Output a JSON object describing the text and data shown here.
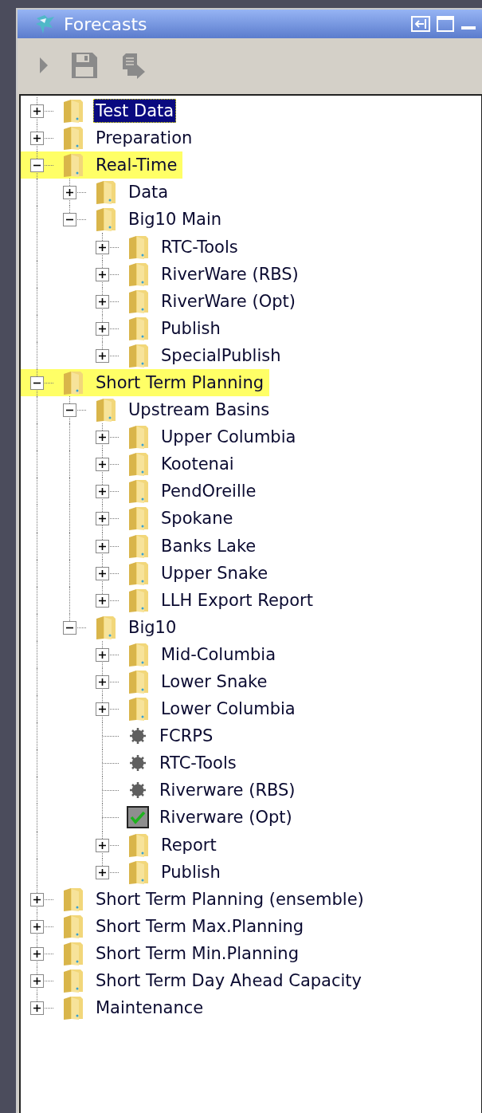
{
  "window": {
    "title": "Forecasts"
  },
  "toolbar": [
    {
      "kind": "run",
      "disabled": true
    },
    {
      "kind": "save",
      "disabled": true
    },
    {
      "kind": "export",
      "disabled": true
    }
  ],
  "tree": [
    {
      "label": "Test Data",
      "kind": "folder",
      "expanded": false,
      "selected": true,
      "highlighted": false
    },
    {
      "label": "Preparation",
      "kind": "folder",
      "expanded": false,
      "selected": false,
      "highlighted": false
    },
    {
      "label": "Real-Time",
      "kind": "folder",
      "expanded": true,
      "selected": false,
      "highlighted": true,
      "children": [
        {
          "label": "Data",
          "kind": "folder",
          "expanded": false,
          "selected": false,
          "highlighted": false
        },
        {
          "label": "Big10 Main",
          "kind": "folder",
          "expanded": true,
          "selected": false,
          "highlighted": false,
          "children": [
            {
              "label": "RTC-Tools",
              "kind": "folder",
              "expanded": false,
              "selected": false,
              "highlighted": false
            },
            {
              "label": "RiverWare (RBS)",
              "kind": "folder",
              "expanded": false,
              "selected": false,
              "highlighted": false
            },
            {
              "label": "RiverWare (Opt)",
              "kind": "folder",
              "expanded": false,
              "selected": false,
              "highlighted": false
            },
            {
              "label": "Publish",
              "kind": "folder",
              "expanded": false,
              "selected": false,
              "highlighted": false
            },
            {
              "label": "SpecialPublish",
              "kind": "folder",
              "expanded": false,
              "selected": false,
              "highlighted": false
            }
          ]
        }
      ]
    },
    {
      "label": "Short Term Planning",
      "kind": "folder",
      "expanded": true,
      "selected": false,
      "highlighted": true,
      "children": [
        {
          "label": "Upstream Basins",
          "kind": "folder",
          "expanded": true,
          "selected": false,
          "highlighted": false,
          "children": [
            {
              "label": "Upper Columbia",
              "kind": "folder",
              "expanded": false,
              "selected": false,
              "highlighted": false
            },
            {
              "label": "Kootenai",
              "kind": "folder",
              "expanded": false,
              "selected": false,
              "highlighted": false
            },
            {
              "label": "PendOreille",
              "kind": "folder",
              "expanded": false,
              "selected": false,
              "highlighted": false
            },
            {
              "label": "Spokane",
              "kind": "folder",
              "expanded": false,
              "selected": false,
              "highlighted": false
            },
            {
              "label": "Banks Lake",
              "kind": "folder",
              "expanded": false,
              "selected": false,
              "highlighted": false
            },
            {
              "label": "Upper Snake",
              "kind": "folder",
              "expanded": false,
              "selected": false,
              "highlighted": false
            },
            {
              "label": "LLH Export Report",
              "kind": "folder",
              "expanded": false,
              "selected": false,
              "highlighted": false
            }
          ]
        },
        {
          "label": "Big10",
          "kind": "folder",
          "expanded": true,
          "selected": false,
          "highlighted": false,
          "children": [
            {
              "label": "Mid-Columbia",
              "kind": "folder",
              "expanded": false,
              "selected": false,
              "highlighted": false
            },
            {
              "label": "Lower Snake",
              "kind": "folder",
              "expanded": false,
              "selected": false,
              "highlighted": false
            },
            {
              "label": "Lower Columbia",
              "kind": "folder",
              "expanded": false,
              "selected": false,
              "highlighted": false
            },
            {
              "label": "FCRPS",
              "kind": "task",
              "checked": false,
              "selected": false,
              "highlighted": false
            },
            {
              "label": "RTC-Tools",
              "kind": "task",
              "checked": false,
              "selected": false,
              "highlighted": false
            },
            {
              "label": "Riverware (RBS)",
              "kind": "task",
              "checked": false,
              "selected": false,
              "highlighted": false
            },
            {
              "label": "Riverware (Opt)",
              "kind": "task",
              "checked": true,
              "selected": false,
              "highlighted": false
            },
            {
              "label": "Report",
              "kind": "folder",
              "expanded": false,
              "selected": false,
              "highlighted": false
            },
            {
              "label": "Publish",
              "kind": "folder",
              "expanded": false,
              "selected": false,
              "highlighted": false
            }
          ]
        }
      ]
    },
    {
      "label": "Short Term Planning (ensemble)",
      "kind": "folder",
      "expanded": false,
      "selected": false,
      "highlighted": false
    },
    {
      "label": "Short Term Max.Planning",
      "kind": "folder",
      "expanded": false,
      "selected": false,
      "highlighted": false
    },
    {
      "label": "Short Term Min.Planning",
      "kind": "folder",
      "expanded": false,
      "selected": false,
      "highlighted": false
    },
    {
      "label": "Short Term Day Ahead Capacity",
      "kind": "folder",
      "expanded": false,
      "selected": false,
      "highlighted": false
    },
    {
      "label": "Maintenance",
      "kind": "folder",
      "expanded": false,
      "selected": false,
      "highlighted": false
    }
  ]
}
